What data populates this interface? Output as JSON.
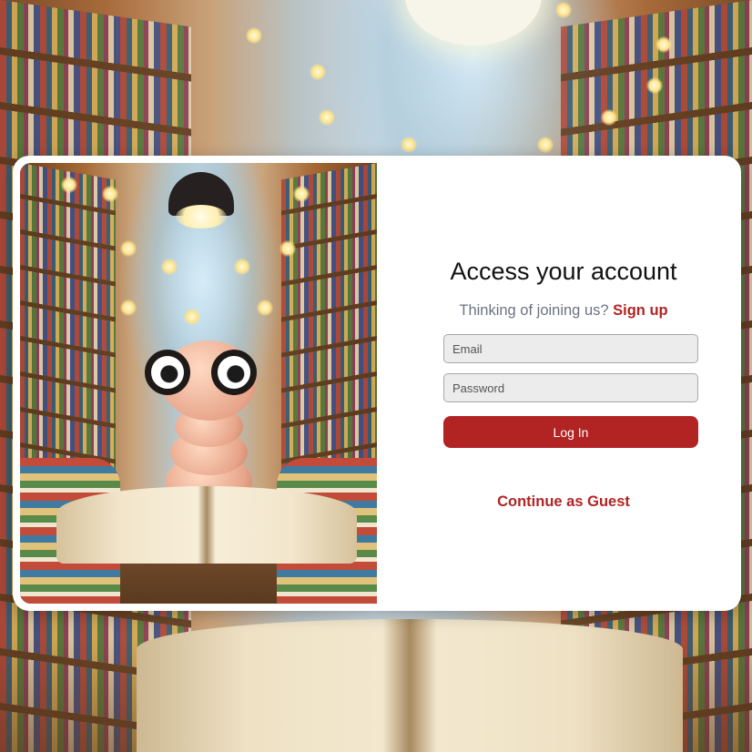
{
  "login": {
    "heading": "Access your account",
    "prompt_text": "Thinking of joining us?",
    "signup_link": "Sign up",
    "email_placeholder": "Email",
    "password_placeholder": "Password",
    "login_button": "Log In",
    "guest_link": "Continue as Guest"
  },
  "colors": {
    "accent": "#b22424",
    "muted_text": "#6b7280",
    "card_background": "#ffffff",
    "input_background": "#ececec"
  },
  "images": {
    "background": "cartoon-library-background",
    "hero": "bookworm-with-glasses-illustration"
  }
}
